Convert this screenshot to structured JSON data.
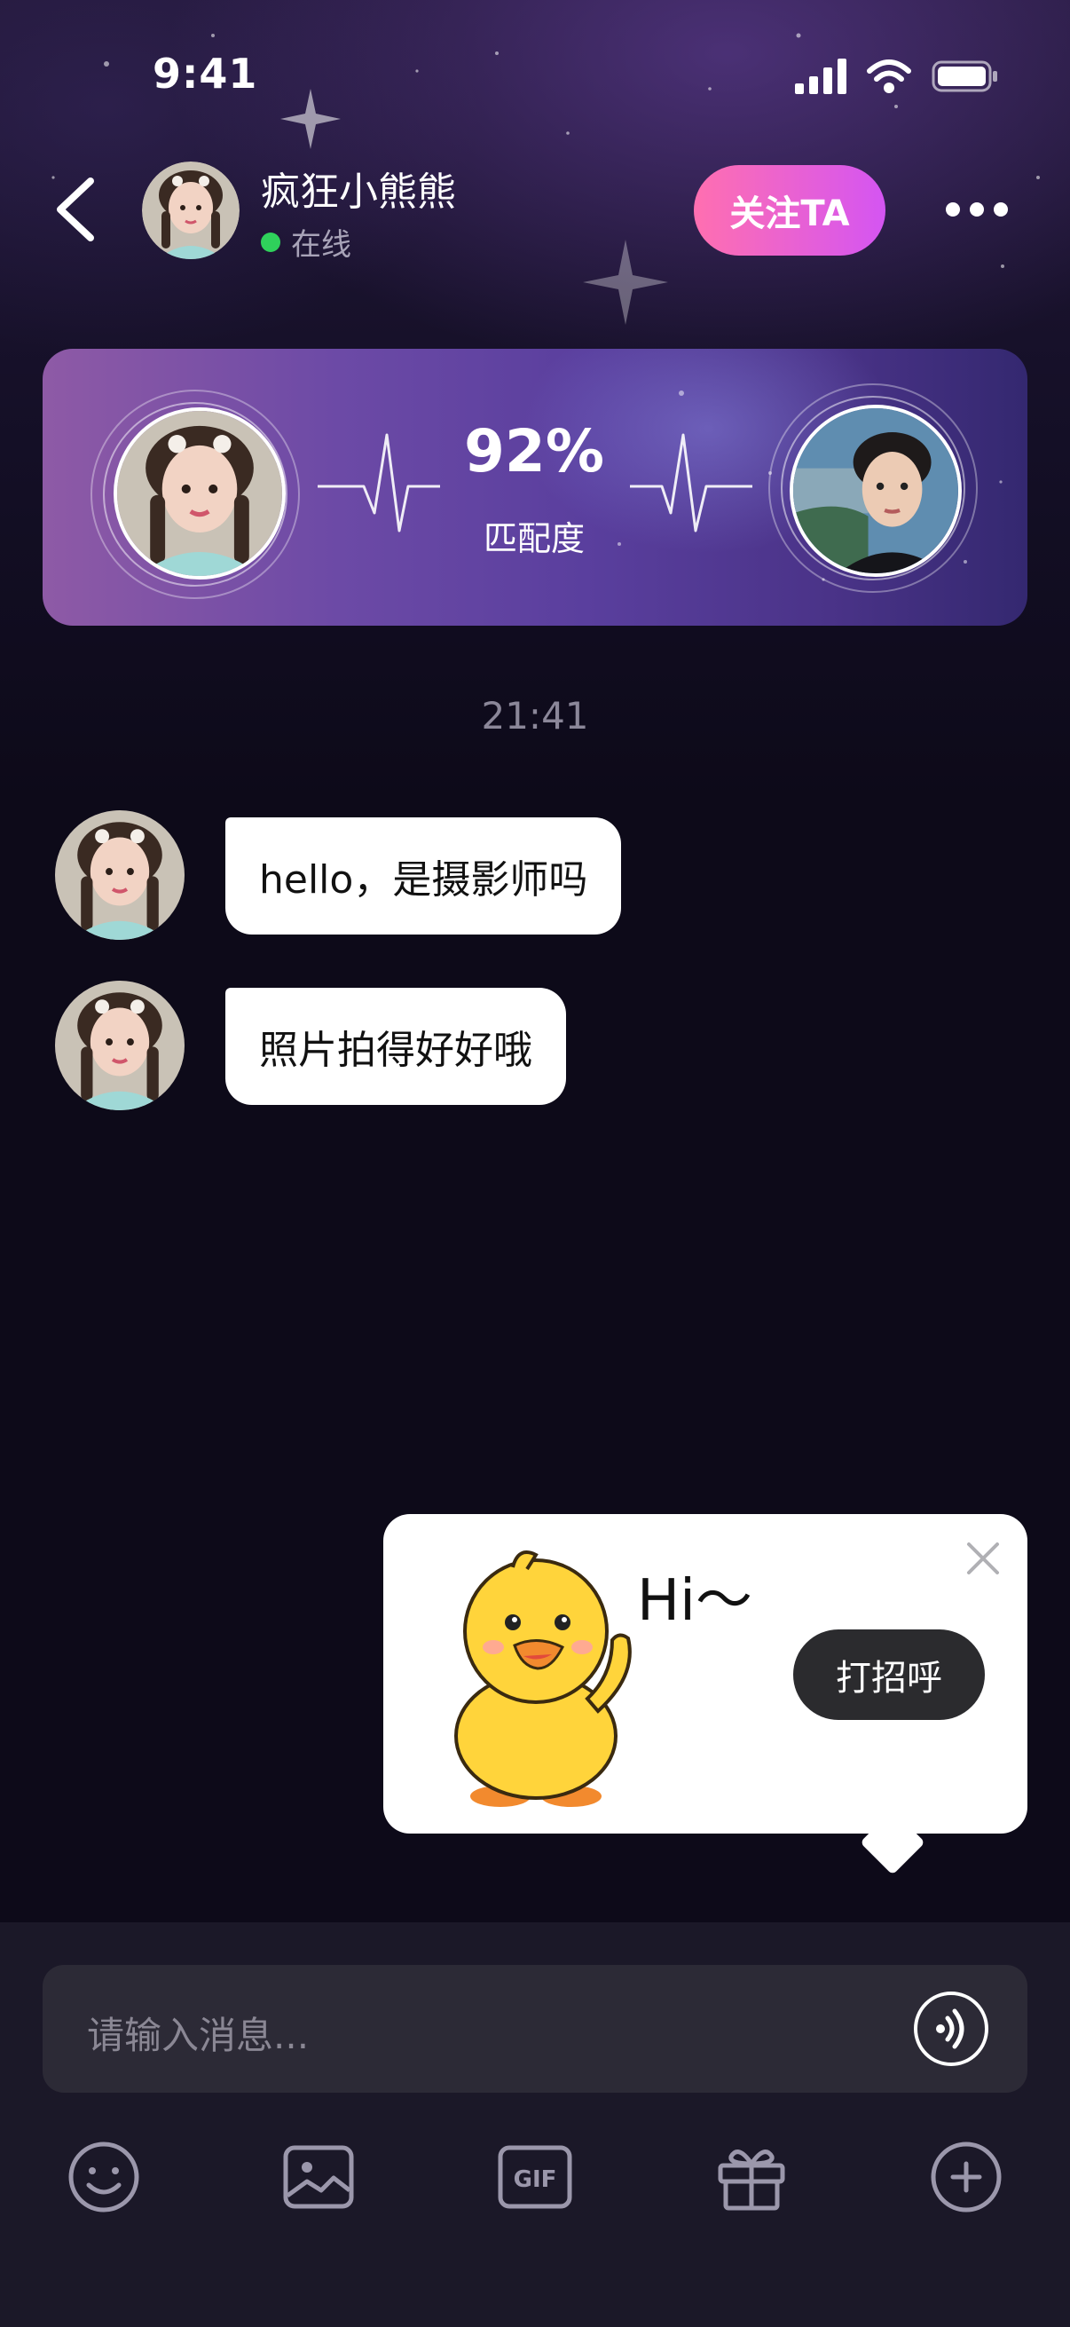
{
  "status_bar": {
    "time": "9:41"
  },
  "header": {
    "contact_name": "疯狂小熊熊",
    "status": "在线",
    "follow_label": "关注TA"
  },
  "match_card": {
    "percent": "92%",
    "label": "匹配度"
  },
  "chat": {
    "timestamp": "21:41",
    "messages": [
      {
        "text": "hello，是摄影师吗"
      },
      {
        "text": "照片拍得好好哦"
      }
    ]
  },
  "greeting_popup": {
    "sticker_text": "Hi～",
    "button_label": "打招呼"
  },
  "input": {
    "placeholder": "请输入消息..."
  },
  "toolbar": {
    "items": [
      "emoji-icon",
      "image-icon",
      "gif-icon",
      "gift-icon",
      "plus-icon"
    ],
    "gif_label": "GIF"
  },
  "colors": {
    "online": "#2fd15b",
    "follow_gradient_start": "#ff6fb0",
    "follow_gradient_end": "#d455f2",
    "background": "#0d0a19"
  }
}
